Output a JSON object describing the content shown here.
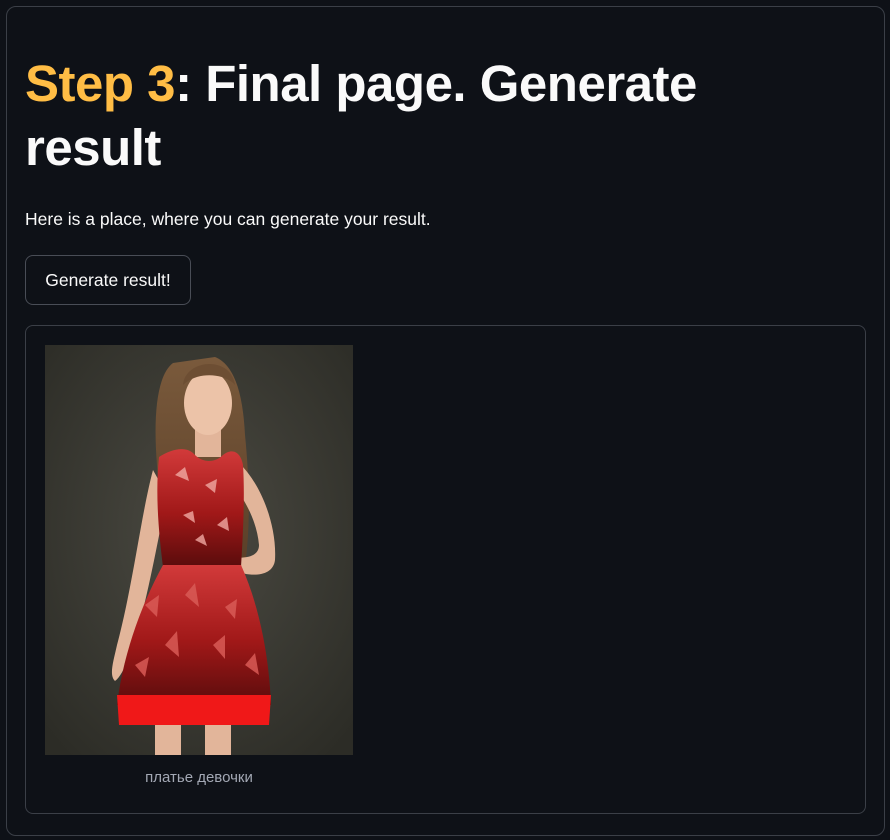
{
  "header": {
    "title_accent": "Step 3",
    "title_rest": ": Final page. Generate result",
    "accent_color": "#ffbd45"
  },
  "description": "Here is a place, where you can generate your result.",
  "generate_button": {
    "label": "Generate result!"
  },
  "result": {
    "image_subject": "woman in red patterned sleeveless dress",
    "caption": "платье девочки"
  }
}
